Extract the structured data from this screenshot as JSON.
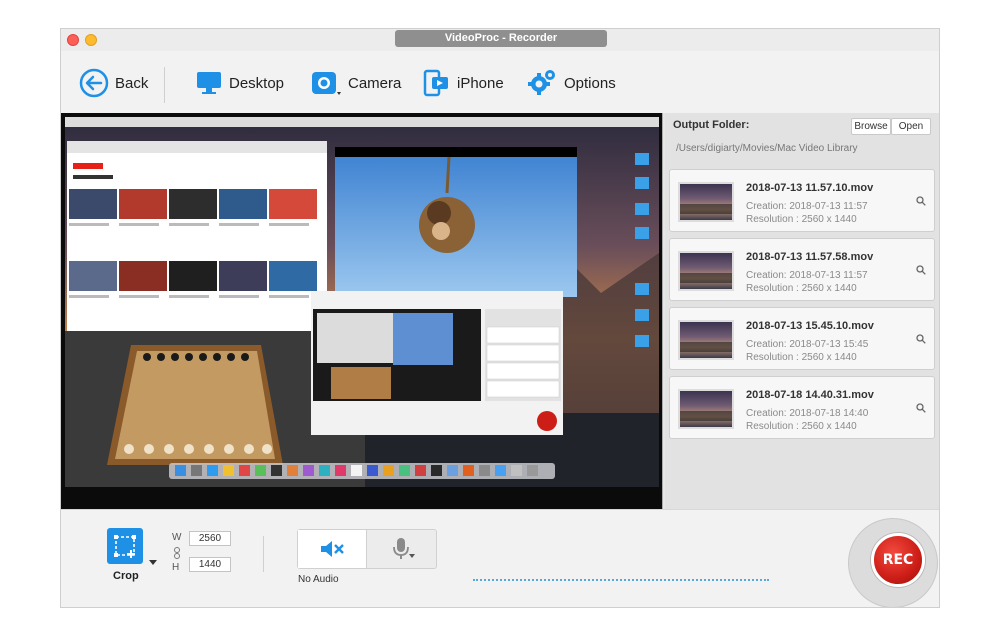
{
  "window": {
    "title": "VideoProc - Recorder"
  },
  "toolbar": {
    "back": "Back",
    "desktop": "Desktop",
    "camera": "Camera",
    "iphone": "iPhone",
    "options": "Options"
  },
  "output": {
    "label": "Output Folder:",
    "browse": "Browse",
    "open": "Open",
    "path": "/Users/digiarty/Movies/Mac Video Library"
  },
  "files": [
    {
      "name": "2018-07-13 11.57.10.mov",
      "creation": "Creation: 2018-07-13 11:57",
      "resolution": "Resolution : 2560 x 1440"
    },
    {
      "name": "2018-07-13 11.57.58.mov",
      "creation": "Creation: 2018-07-13 11:57",
      "resolution": "Resolution : 2560 x 1440"
    },
    {
      "name": "2018-07-13 15.45.10.mov",
      "creation": "Creation: 2018-07-13 15:45",
      "resolution": "Resolution : 2560 x 1440"
    },
    {
      "name": "2018-07-18 14.40.31.mov",
      "creation": "Creation: 2018-07-18 14:40",
      "resolution": "Resolution : 2560 x 1440"
    }
  ],
  "bottom": {
    "crop": "Crop",
    "w_label": "W",
    "h_label": "H",
    "width": "2560",
    "height": "1440",
    "no_audio": "No Audio",
    "rec": "REC"
  },
  "colors": {
    "accent": "#1e90e6",
    "rec": "#cc1d17"
  },
  "icons": [
    "back-icon",
    "desktop-icon",
    "camera-icon",
    "iphone-icon",
    "options-icon",
    "crop-icon",
    "speaker-mute-icon",
    "microphone-icon",
    "magnifier-icon"
  ]
}
